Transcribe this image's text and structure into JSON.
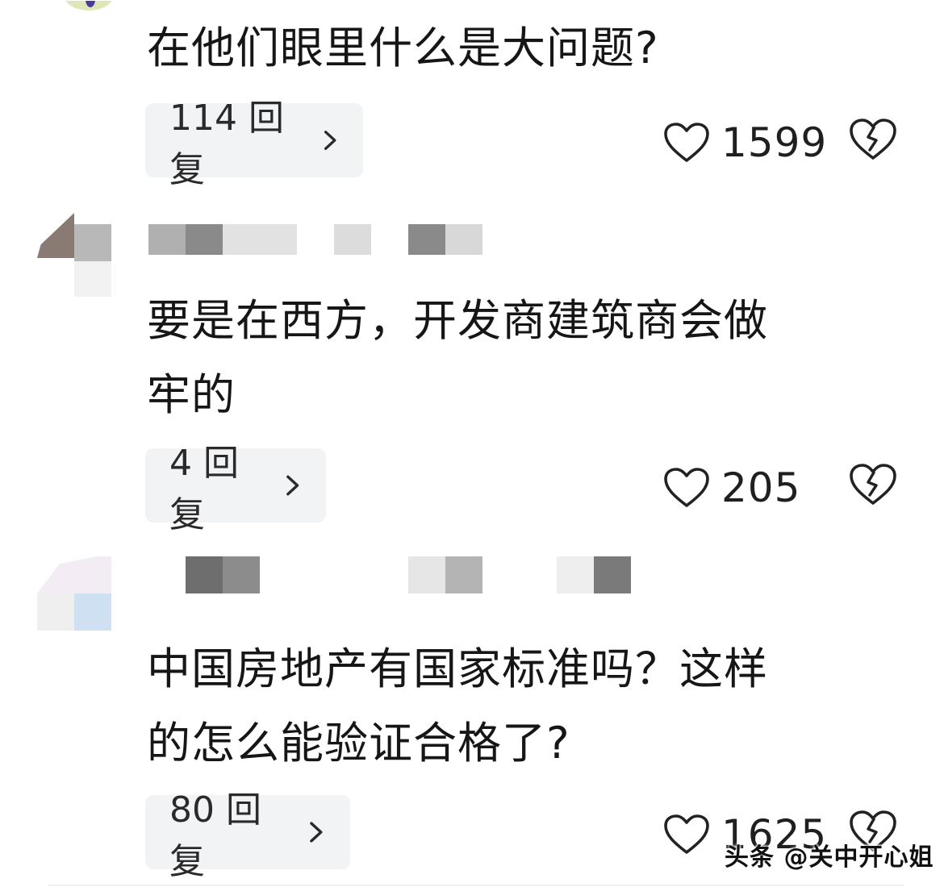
{
  "comments": [
    {
      "text": "在他们眼里什么是大问题?",
      "reply_label": "114 回复",
      "likes": "1599"
    },
    {
      "text": "要是在西方，开发商建筑商会做\n牢的",
      "reply_label": "4 回复",
      "likes": "205"
    },
    {
      "text": "中国房地产有国家标准吗？这样\n的怎么能验证合格了?",
      "reply_label": "80 回复",
      "likes": "1625"
    }
  ],
  "watermark": "头条 @关中开心姐",
  "icons": {
    "like": "heart-outline-icon",
    "dislike": "broken-heart-icon",
    "reply_arrow": "chevron-right-icon"
  },
  "colors": {
    "reply_bg": "#f2f3f5",
    "text": "#161616",
    "icon_stroke": "#222222"
  }
}
